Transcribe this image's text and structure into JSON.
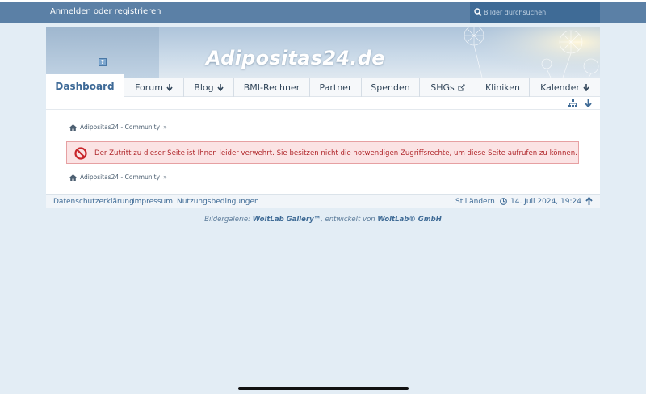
{
  "topbar": {
    "login_label": "Anmelden oder registrieren",
    "search_placeholder": "Bilder durchsuchen"
  },
  "header": {
    "site_title": "Adipositas24.de",
    "help_icon": "?"
  },
  "nav": {
    "items": [
      {
        "label": "Dashboard",
        "active": true,
        "icon": null
      },
      {
        "label": "Forum",
        "icon": "arrow-down-icon"
      },
      {
        "label": "Blog",
        "icon": "arrow-down-icon"
      },
      {
        "label": "BMI-Rechner",
        "icon": null
      },
      {
        "label": "Partner",
        "icon": null
      },
      {
        "label": "Spenden",
        "icon": null
      },
      {
        "label": "SHGs",
        "icon": "external-link-icon"
      },
      {
        "label": "Kliniken",
        "icon": null
      },
      {
        "label": "Kalender",
        "icon": "arrow-down-icon"
      }
    ]
  },
  "breadcrumb": {
    "label": "Adipositas24 - Community",
    "separator": "»"
  },
  "error": {
    "message": "Der Zutritt zu dieser Seite ist Ihnen leider verwehrt. Sie besitzen nicht die notwendigen Zugriffsrechte, um diese Seite aufrufen zu können."
  },
  "footer": {
    "links": [
      "Datenschutzerklärung",
      "Impressum",
      "Nutzungsbedingungen"
    ],
    "style_label": "Stil ändern",
    "datetime": "14. Juli 2024, 19:24"
  },
  "credits": {
    "prefix": "Bildergalerie: ",
    "product": "WoltLab Gallery™",
    "middle": ", entwickelt von ",
    "company": "WoltLab® GmbH"
  },
  "colors": {
    "topbar": "#5b80a6",
    "accent": "#3f6b96",
    "error_text": "#b0272b",
    "error_bg": "#fbe3e4",
    "page_bg": "#e3edf5"
  }
}
